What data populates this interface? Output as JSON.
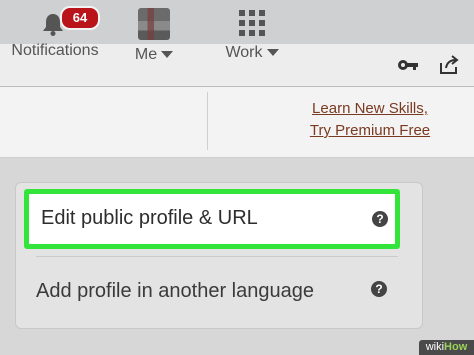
{
  "nav": {
    "notifications": {
      "label": "Notifications",
      "badge": "64"
    },
    "me": {
      "label": "Me"
    },
    "work": {
      "label": "Work"
    },
    "premium": {
      "line1": "Learn New Skills,",
      "line2": "Try Premium Free"
    }
  },
  "profile_menu": {
    "edit_public": "Edit public profile & URL",
    "add_language": "Add profile in another language",
    "help_glyph": "?"
  },
  "colors": {
    "highlight": "#33e43a",
    "badge": "#b8141a",
    "premium_link": "#7a3a22"
  },
  "watermark": {
    "prefix": "wiki",
    "suffix": "How"
  }
}
